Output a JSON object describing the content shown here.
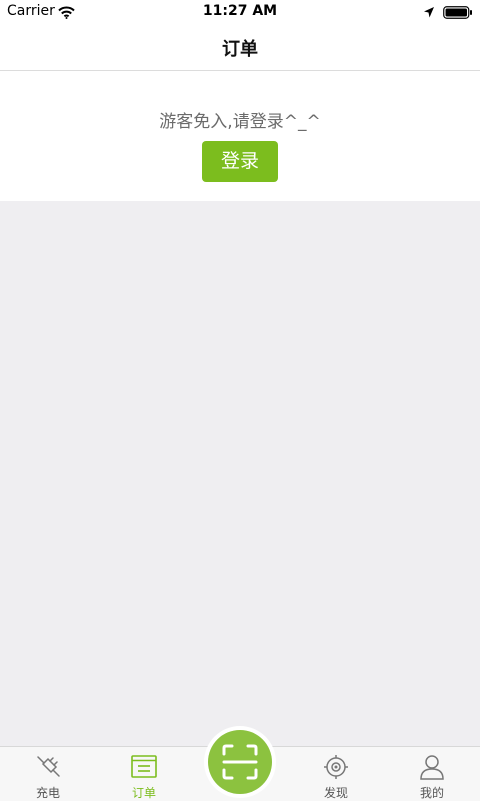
{
  "status_bar": {
    "carrier": "Carrier",
    "time": "11:27 AM",
    "icons": [
      "wifi-icon",
      "location-arrow-icon",
      "battery-icon"
    ]
  },
  "header": {
    "title": "订单"
  },
  "guest": {
    "message": "游客免入,请登录^_^",
    "login_label": "登录"
  },
  "tab_bar": {
    "tabs": [
      {
        "label": "充电",
        "icon": "plug-icon",
        "active": false
      },
      {
        "label": "订单",
        "icon": "order-list-icon",
        "active": true
      },
      {
        "label": "发现",
        "icon": "target-icon",
        "active": false
      },
      {
        "label": "我的",
        "icon": "user-icon",
        "active": false
      }
    ],
    "center_icon": "scan-icon"
  },
  "colors": {
    "accent": "#7cbd1e",
    "scan_button": "#8cc23f",
    "content_background": "#efeef1"
  }
}
